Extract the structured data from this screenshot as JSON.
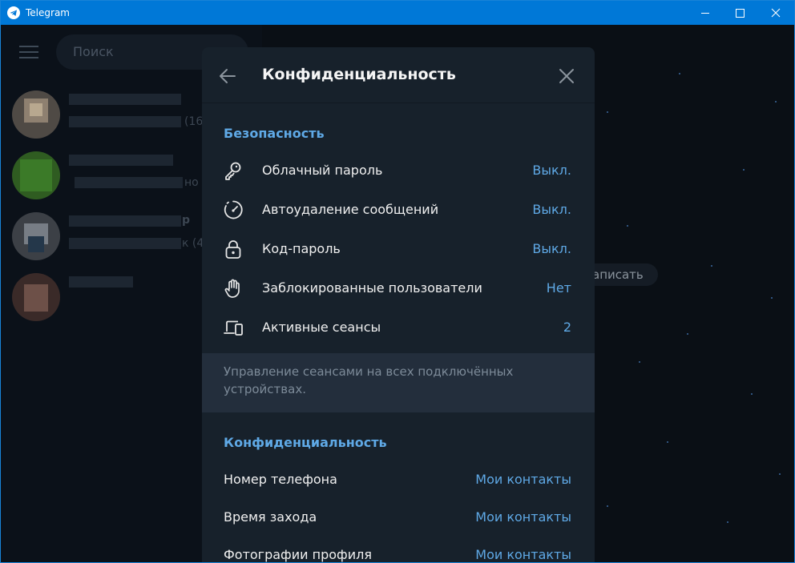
{
  "window": {
    "title": "Telegram"
  },
  "sidebar": {
    "search_placeholder": "Поиск",
    "chats": [
      {
        "preview_tail": "(16"
      },
      {
        "preview_tail": "но б"
      },
      {
        "name_tail": "р",
        "preview_tail": "к (4"
      },
      {}
    ]
  },
  "chat_area": {
    "action_pill": "аписать"
  },
  "modal": {
    "title": "Конфиденциальность",
    "security": {
      "heading": "Безопасность",
      "items": [
        {
          "icon": "key-icon",
          "label": "Облачный пароль",
          "value": "Выкл."
        },
        {
          "icon": "timer-icon",
          "label": "Автоудаление сообщений",
          "value": "Выкл."
        },
        {
          "icon": "lock-icon",
          "label": "Код-пароль",
          "value": "Выкл."
        },
        {
          "icon": "hand-icon",
          "label": "Заблокированные пользователи",
          "value": "Нет"
        },
        {
          "icon": "devices-icon",
          "label": "Активные сеансы",
          "value": "2"
        }
      ],
      "hint": "Управление сеансами на всех подключённых устройствах."
    },
    "privacy": {
      "heading": "Конфиденциальность",
      "items": [
        {
          "label": "Номер телефона",
          "value": "Мои контакты"
        },
        {
          "label": "Время захода",
          "value": "Мои контакты"
        },
        {
          "label": "Фотографии профиля",
          "value": "Мои контакты"
        }
      ]
    }
  },
  "colors": {
    "accent": "#5fa9e6",
    "modal_bg": "#17212b",
    "titlebar": "#0078d7"
  }
}
